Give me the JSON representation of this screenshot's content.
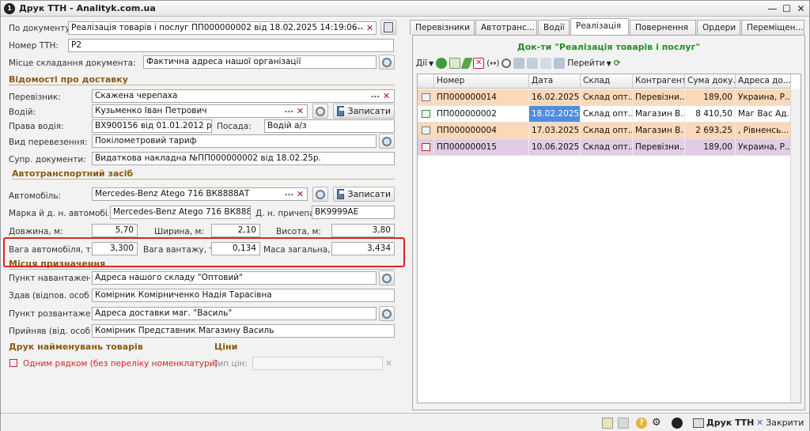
{
  "window": {
    "title": "Друк ТТН - Analityk.com.ua"
  },
  "form": {
    "po_dokumentu_label": "По документу:",
    "po_dokumentu_value": "Реалізація товарів і послуг ПП000000002 від 18.02.2025 14:19:06",
    "nomer_ttn_label": "Номер ТТН:",
    "nomer_ttn_value": "Р2",
    "misce_label": "Місце складання документа:",
    "misce_value": "Фактична адреса нашої організації",
    "section_delivery": "Відомості про доставку",
    "perevoznyk_label": "Перевізник:",
    "perevoznyk_value": "Скажена черепаха",
    "vodiy_label": "Водій:",
    "vodiy_value": "Кузьменко Іван Петрович",
    "zapysaty_label": "Записати",
    "prava_label": "Права водія:",
    "prava_value": "ВХ900156 від 01.01.2012 року",
    "posada_label": "Посада:",
    "posada_value": "Водій а/з",
    "vyd_label": "Вид перевезення:",
    "vyd_value": "Покілометровий тариф",
    "supr_label": "Супр. документи:",
    "supr_value": "Видаткова накладна №ПП000000002 від 18.02.25р.",
    "section_auto": "Автотранспортний засіб",
    "avto_label": "Автомобіль:",
    "avto_value": "Mercedes-Benz Atego 716 ВК8888АТ",
    "marka_label": "Марка й д. н. автомобіля:",
    "marka_value": "Mercedes-Benz Atego 716 ВК8888АТ",
    "prychep_label": "Д. н. причепа:",
    "prychep_value": "ВК9999АЕ",
    "dovzhyna_label": "Довжина, м:",
    "dovzhyna_value": "5,70",
    "shyryna_label": "Ширина, м:",
    "shyryna_value": "2,10",
    "vysota_label": "Висота, м:",
    "vysota_value": "3,80",
    "vaga_avto_label": "Вага автомобіля, т",
    "vaga_avto_value": "3,300",
    "vaga_vantazhu_label": "Вага вантажу, т",
    "vaga_vantazhu_value": "0,134",
    "masa_label": "Маса загальна, т:",
    "masa_value": "3,434",
    "section_places": "Місця призначення",
    "punkt_nav_label": "Пункт навантажен...",
    "punkt_nav_value": "Адреса нашого складу \"Оптовий\"",
    "zdav_label": "Здав (відпов. особ...",
    "zdav_value": "Комірник Комірниченко Надія Тарасівна",
    "punkt_rozv_label": "Пункт розвантаже...",
    "punkt_rozv_value": "Адреса доставки маг. \"Василь\"",
    "pryinyav_label": "Прийняв (від. особ...",
    "pryinyav_value": "Комірник Представник Магазину Василь",
    "section_print": "Друк найменувань товарів",
    "section_prices": "Ціни",
    "odnym_label": "Одним рядком (без переліку номенклатури)",
    "typ_cin_label": "Тип цін:"
  },
  "right": {
    "tabs": [
      "Перевізники",
      "Автотранс...",
      "Водії",
      "Реалізація",
      "Повернення",
      "Ордери",
      "Переміщен..."
    ],
    "panel_title": "Док-ти \"Реалізація товарів і послуг\"",
    "actions_label": "Дії",
    "goto_label": "Перейти",
    "columns": [
      "Номер",
      "Дата",
      "Склад",
      "Контрагент",
      "Сума доку...",
      "Адреса до..."
    ],
    "rows": [
      {
        "num": "ПП000000014",
        "date": "16.02.2025 ...",
        "sklad": "Склад опт...",
        "kontr": "Перевізни...",
        "suma": "189,00",
        "adr": "Украина, Р..."
      },
      {
        "num": "ПП000000002",
        "date": "18.02.2025 ...",
        "sklad": "Склад опт...",
        "kontr": "Магазин В...",
        "suma": "8 410,50",
        "adr": "Маг Вас Ад..."
      },
      {
        "num": "ПП000000004",
        "date": "17.03.2025 ...",
        "sklad": "Склад опт...",
        "kontr": "Магазин В...",
        "suma": "2 693,25",
        "adr": ", Рівненсь..."
      },
      {
        "num": "ПП000000015",
        "date": "10.06.2025 ...",
        "sklad": "Склад опт...",
        "kontr": "Перевізни...",
        "suma": "189,00",
        "adr": "Украина, Р..."
      }
    ]
  },
  "statusbar": {
    "print_ttn_label": "Друк ТТН",
    "close_label": "Закрити"
  },
  "colors": {
    "section": "#8b5a12",
    "panel_title": "#2a8a2a",
    "highlight_box": "#e02424",
    "row_orange": "#fbd9b8",
    "row_purple": "#e1cde3",
    "row_selected": "#4f8de0"
  }
}
